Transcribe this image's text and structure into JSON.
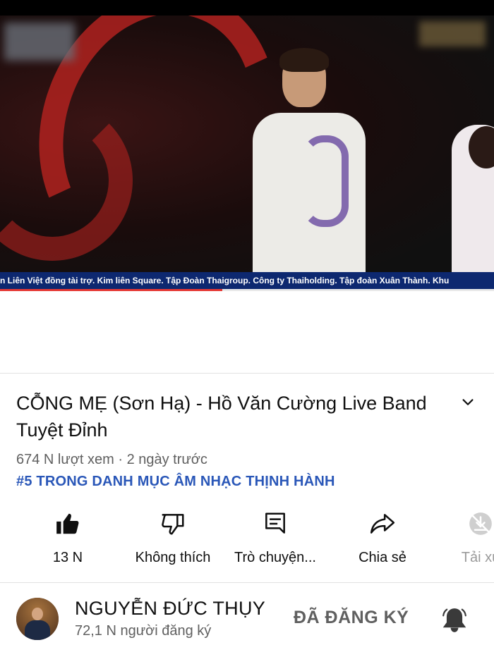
{
  "video": {
    "ticker_text": "n Liên Việt đồng tài trợ. Kim liên Square. Tập Đoàn Thaigroup. Công ty Thaiholding. Tập đoàn Xuân Thành. Khu",
    "progress": 0.45,
    "accent_color": "#e53935",
    "ticker_color": "#0d2870"
  },
  "details": {
    "title": "CỖNG MẸ (Sơn Hạ) - Hồ Văn Cường Live Band Tuyệt Đỉnh",
    "views": "674 N lượt xem",
    "separator": " · ",
    "uploaded": "2 ngày trước",
    "trending": "#5 TRONG DANH MỤC ÂM NHẠC THỊNH HÀNH",
    "expand_icon": "chevron-down-icon"
  },
  "actions": [
    {
      "icon": "thumbs-up-icon",
      "label": "13 N"
    },
    {
      "icon": "thumbs-down-icon",
      "label": "Không thích"
    },
    {
      "icon": "chat-icon",
      "label": "Trò chuyện..."
    },
    {
      "icon": "share-icon",
      "label": "Chia sẻ"
    },
    {
      "icon": "download-disabled-icon",
      "label": "Tải xu"
    }
  ],
  "channel": {
    "name": "NGUYỄN ĐỨC THỤY",
    "subscribers": "72,1 N người đăng ký",
    "subscribe_label": "ĐÃ ĐĂNG KÝ",
    "bell_icon": "bell-icon"
  }
}
